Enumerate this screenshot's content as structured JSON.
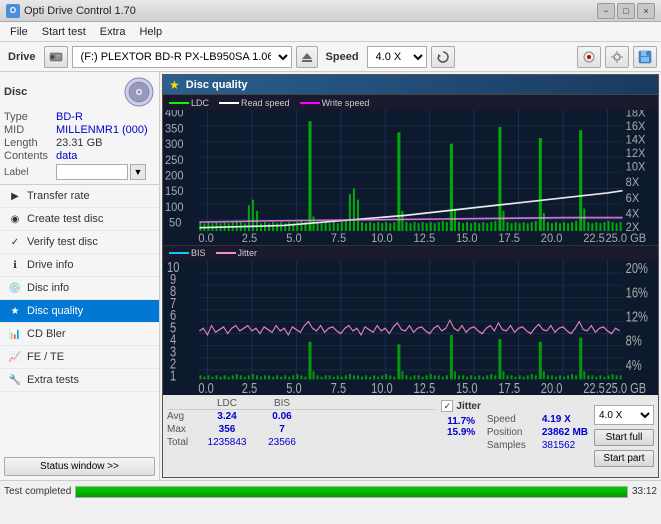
{
  "app": {
    "title": "Opti Drive Control 1.70",
    "icon": "O"
  },
  "titlebar": {
    "minimize": "−",
    "maximize": "□",
    "close": "×"
  },
  "menu": {
    "items": [
      "File",
      "Start test",
      "Extra",
      "Help"
    ]
  },
  "toolbar": {
    "drive_label": "Drive",
    "drive_value": "(F:)  PLEXTOR BD-R  PX-LB950SA 1.06",
    "speed_label": "Speed",
    "speed_value": "4.0 X"
  },
  "disc": {
    "section_title": "Disc",
    "type_key": "Type",
    "type_val": "BD-R",
    "mid_key": "MID",
    "mid_val": "MILLENMR1 (000)",
    "length_key": "Length",
    "length_val": "23.31 GB",
    "contents_key": "Contents",
    "contents_val": "data",
    "label_key": "Label",
    "label_val": ""
  },
  "nav": {
    "items": [
      {
        "id": "transfer-rate",
        "label": "Transfer rate",
        "icon": "▶"
      },
      {
        "id": "create-test-disc",
        "label": "Create test disc",
        "icon": "◉"
      },
      {
        "id": "verify-test-disc",
        "label": "Verify test disc",
        "icon": "✓"
      },
      {
        "id": "drive-info",
        "label": "Drive info",
        "icon": "ℹ"
      },
      {
        "id": "disc-info",
        "label": "Disc info",
        "icon": "💿"
      },
      {
        "id": "disc-quality",
        "label": "Disc quality",
        "icon": "★",
        "active": true
      },
      {
        "id": "cd-bler",
        "label": "CD Bler",
        "icon": "📊"
      },
      {
        "id": "fe-te",
        "label": "FE / TE",
        "icon": "📈"
      },
      {
        "id": "extra-tests",
        "label": "Extra tests",
        "icon": "🔧"
      }
    ]
  },
  "disc_quality": {
    "panel_title": "Disc quality",
    "legend": {
      "ldc": "LDC",
      "read_speed": "Read speed",
      "write_speed": "Write speed",
      "bis": "BIS",
      "jitter": "Jitter"
    },
    "top_chart": {
      "y_max": 400,
      "y_labels_left": [
        "400",
        "350",
        "300",
        "250",
        "200",
        "150",
        "100",
        "50"
      ],
      "y_labels_right": [
        "18X",
        "16X",
        "14X",
        "12X",
        "10X",
        "8X",
        "6X",
        "4X",
        "2X"
      ],
      "x_labels": [
        "0.0",
        "2.5",
        "5.0",
        "7.5",
        "10.0",
        "12.5",
        "15.0",
        "17.5",
        "20.0",
        "22.5",
        "25.0 GB"
      ]
    },
    "bottom_chart": {
      "y_max": 10,
      "y_labels_left": [
        "10",
        "9",
        "8",
        "7",
        "6",
        "5",
        "4",
        "3",
        "2",
        "1"
      ],
      "y_labels_right": [
        "20%",
        "16%",
        "12%",
        "8%",
        "4%"
      ],
      "x_labels": [
        "0.0",
        "2.5",
        "5.0",
        "7.5",
        "10.0",
        "12.5",
        "15.0",
        "17.5",
        "20.0",
        "22.5",
        "25.0 GB"
      ]
    },
    "stats": {
      "headers": [
        "LDC",
        "BIS",
        "",
        "Jitter",
        "Speed"
      ],
      "avg_label": "Avg",
      "avg_ldc": "3.24",
      "avg_bis": "0.06",
      "avg_jitter": "11.7%",
      "avg_speed": "4.19 X",
      "max_label": "Max",
      "max_ldc": "356",
      "max_bis": "7",
      "max_jitter": "15.9%",
      "total_label": "Total",
      "total_ldc": "1235843",
      "total_bis": "23566",
      "position_label": "Position",
      "position_val": "23862 MB",
      "samples_label": "Samples",
      "samples_val": "381562",
      "speed_current": "4.0 X"
    },
    "buttons": {
      "start_full": "Start full",
      "start_part": "Start part"
    }
  },
  "statusbar": {
    "status_text": "Test completed",
    "progress": 100,
    "time": "33:12"
  }
}
